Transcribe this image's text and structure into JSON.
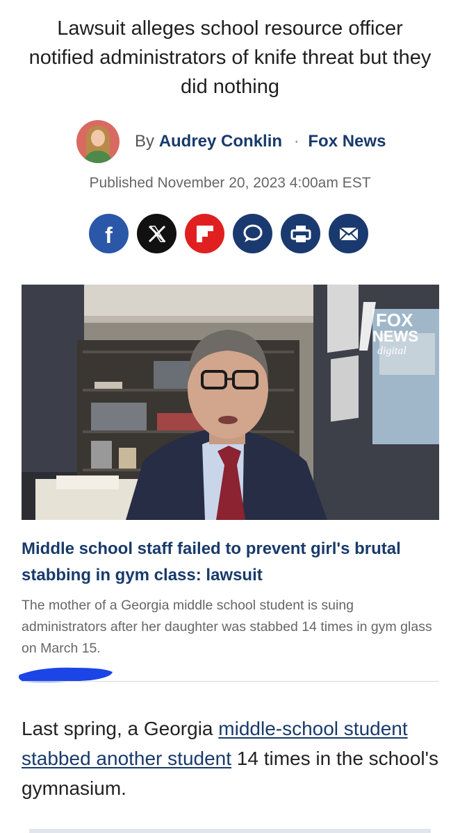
{
  "article": {
    "headline": "Lawsuit alleges school resource officer notified administrators of knife threat but they did nothing",
    "byline_prefix": "By",
    "author": "Audrey Conklin",
    "separator": "·",
    "outlet": "Fox News",
    "published": "Published November 20, 2023 4:00am EST"
  },
  "share": {
    "buttons": [
      {
        "icon": "facebook-icon",
        "label": "f"
      },
      {
        "icon": "x-icon"
      },
      {
        "icon": "flipboard-icon"
      },
      {
        "icon": "comment-icon"
      },
      {
        "icon": "print-icon"
      },
      {
        "icon": "email-icon"
      }
    ]
  },
  "video": {
    "watermark_line1": "FOX",
    "watermark_line2": "NEWS",
    "watermark_line3": "digital"
  },
  "card": {
    "title": "Middle school staff failed to prevent girl's brutal stabbing in gym class: lawsuit",
    "description": "The mother of a Georgia middle school student is suing administrators after her daughter was stabbed 14 times in gym glass on March 15."
  },
  "body": {
    "before_link": "Last spring, a Georgia ",
    "link_text": "middle-school student stabbed another student",
    "after_link": " 14 times in the school's gymnasium."
  },
  "colors": {
    "link_navy": "#183a6b",
    "facebook": "#2a57a8",
    "flipboard": "#e02020",
    "ink_mark": "#1b45e6"
  }
}
